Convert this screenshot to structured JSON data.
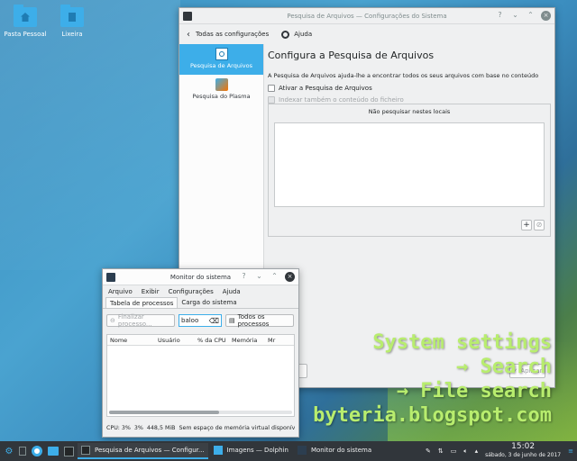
{
  "desktop": {
    "icons": [
      {
        "label": "Pasta Pessoal",
        "name": "home-folder"
      },
      {
        "label": "Lixeira",
        "name": "trash-folder"
      }
    ]
  },
  "settings": {
    "title": "Pesquisa de Arquivos — Configurações do Sistema",
    "back_label": "Todas as configurações",
    "help_label": "Ajuda",
    "sidebar": [
      {
        "label": "Pesquisa de Arquivos",
        "active": true
      },
      {
        "label": "Pesquisa do Plasma",
        "active": false
      }
    ],
    "heading": "Configura a Pesquisa de Arquivos",
    "description": "A Pesquisa de Arquivos ajuda-lhe a encontrar todos os seus arquivos com base no conteúdo",
    "enable_label": "Ativar a Pesquisa de Arquivos",
    "index_label": "Indexar também o conteúdo do ficheiro",
    "exclude_header": "Não pesquisar nestes locais",
    "apply_label": "Aplicar"
  },
  "monitor": {
    "title": "Monitor do sistema",
    "menu": [
      "Arquivo",
      "Exibir",
      "Configurações",
      "Ajuda"
    ],
    "tabs": [
      "Tabela de processos",
      "Carga do sistema"
    ],
    "end_process_label": "Finalizar processo...",
    "search_value": "baloo",
    "filter_label": "Todos os processos",
    "columns": [
      "Nome",
      "Usuário",
      "% da CPU",
      "Memória",
      "Mr"
    ],
    "status": {
      "cpu": "CPU: 3%",
      "mem_pct": "3%",
      "mem": "448,5 MiB",
      "swap": "Sem espaço de memória virtual disponív"
    }
  },
  "taskbar": {
    "tasks": [
      {
        "label": "Pesquisa de Arquivos — Configur...",
        "active": true
      },
      {
        "label": "Imagens — Dolphin",
        "active": false
      },
      {
        "label": "Monitor do sistema",
        "active": false
      }
    ],
    "time": "15:02",
    "date": "sábado, 3 de junho de 2017"
  },
  "overlay": {
    "lines": [
      "System settings",
      "→ Search",
      "→ File search",
      "byteria.blogspot.com"
    ],
    "color": "#b8ed6e"
  }
}
